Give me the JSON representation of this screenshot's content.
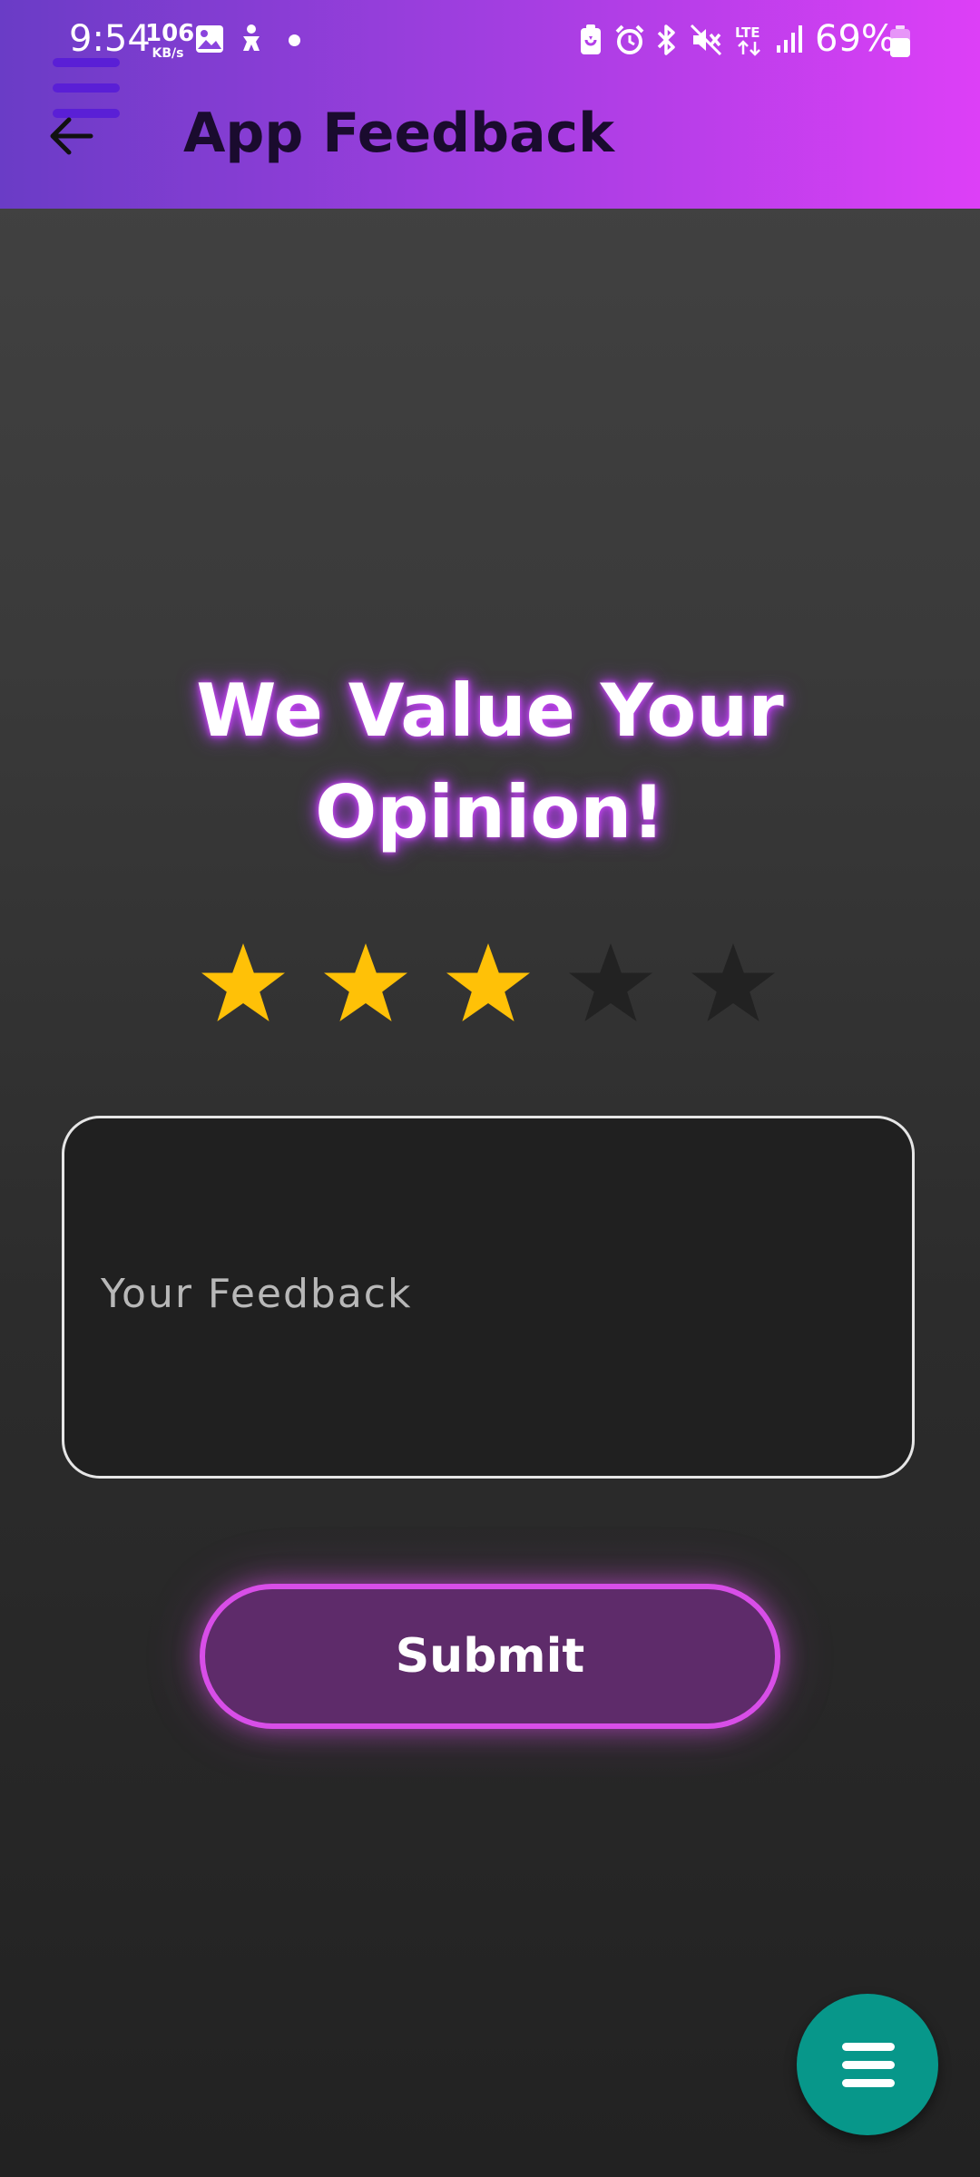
{
  "status_bar": {
    "time": "9:54",
    "net_speed_value": "106",
    "net_speed_unit": "KB/s",
    "battery_percent": "69%",
    "icons": [
      "gallery-icon",
      "accessibility-icon",
      "notification-dot-icon",
      "battery-saver-icon",
      "alarm-icon",
      "bluetooth-icon",
      "mute-icon",
      "lte-icon",
      "signal-icon",
      "battery-icon"
    ]
  },
  "header": {
    "title": "App Feedback",
    "back_icon": "arrow-left-icon",
    "menu_icon": "hamburger-icon",
    "gradient_colors": [
      "#6a3cc6",
      "#dd3ff7"
    ]
  },
  "main": {
    "heading": "We Value Your Opinion!",
    "rating": {
      "value": 3,
      "max": 5,
      "filled_color": "#ffc107",
      "empty_color": "#222222"
    },
    "feedback_input": {
      "placeholder": "Your Feedback",
      "value": ""
    },
    "submit_label": "Submit",
    "submit_accent": "#d84ee8"
  },
  "fab": {
    "icon": "hamburger-icon",
    "color": "#07978a"
  }
}
